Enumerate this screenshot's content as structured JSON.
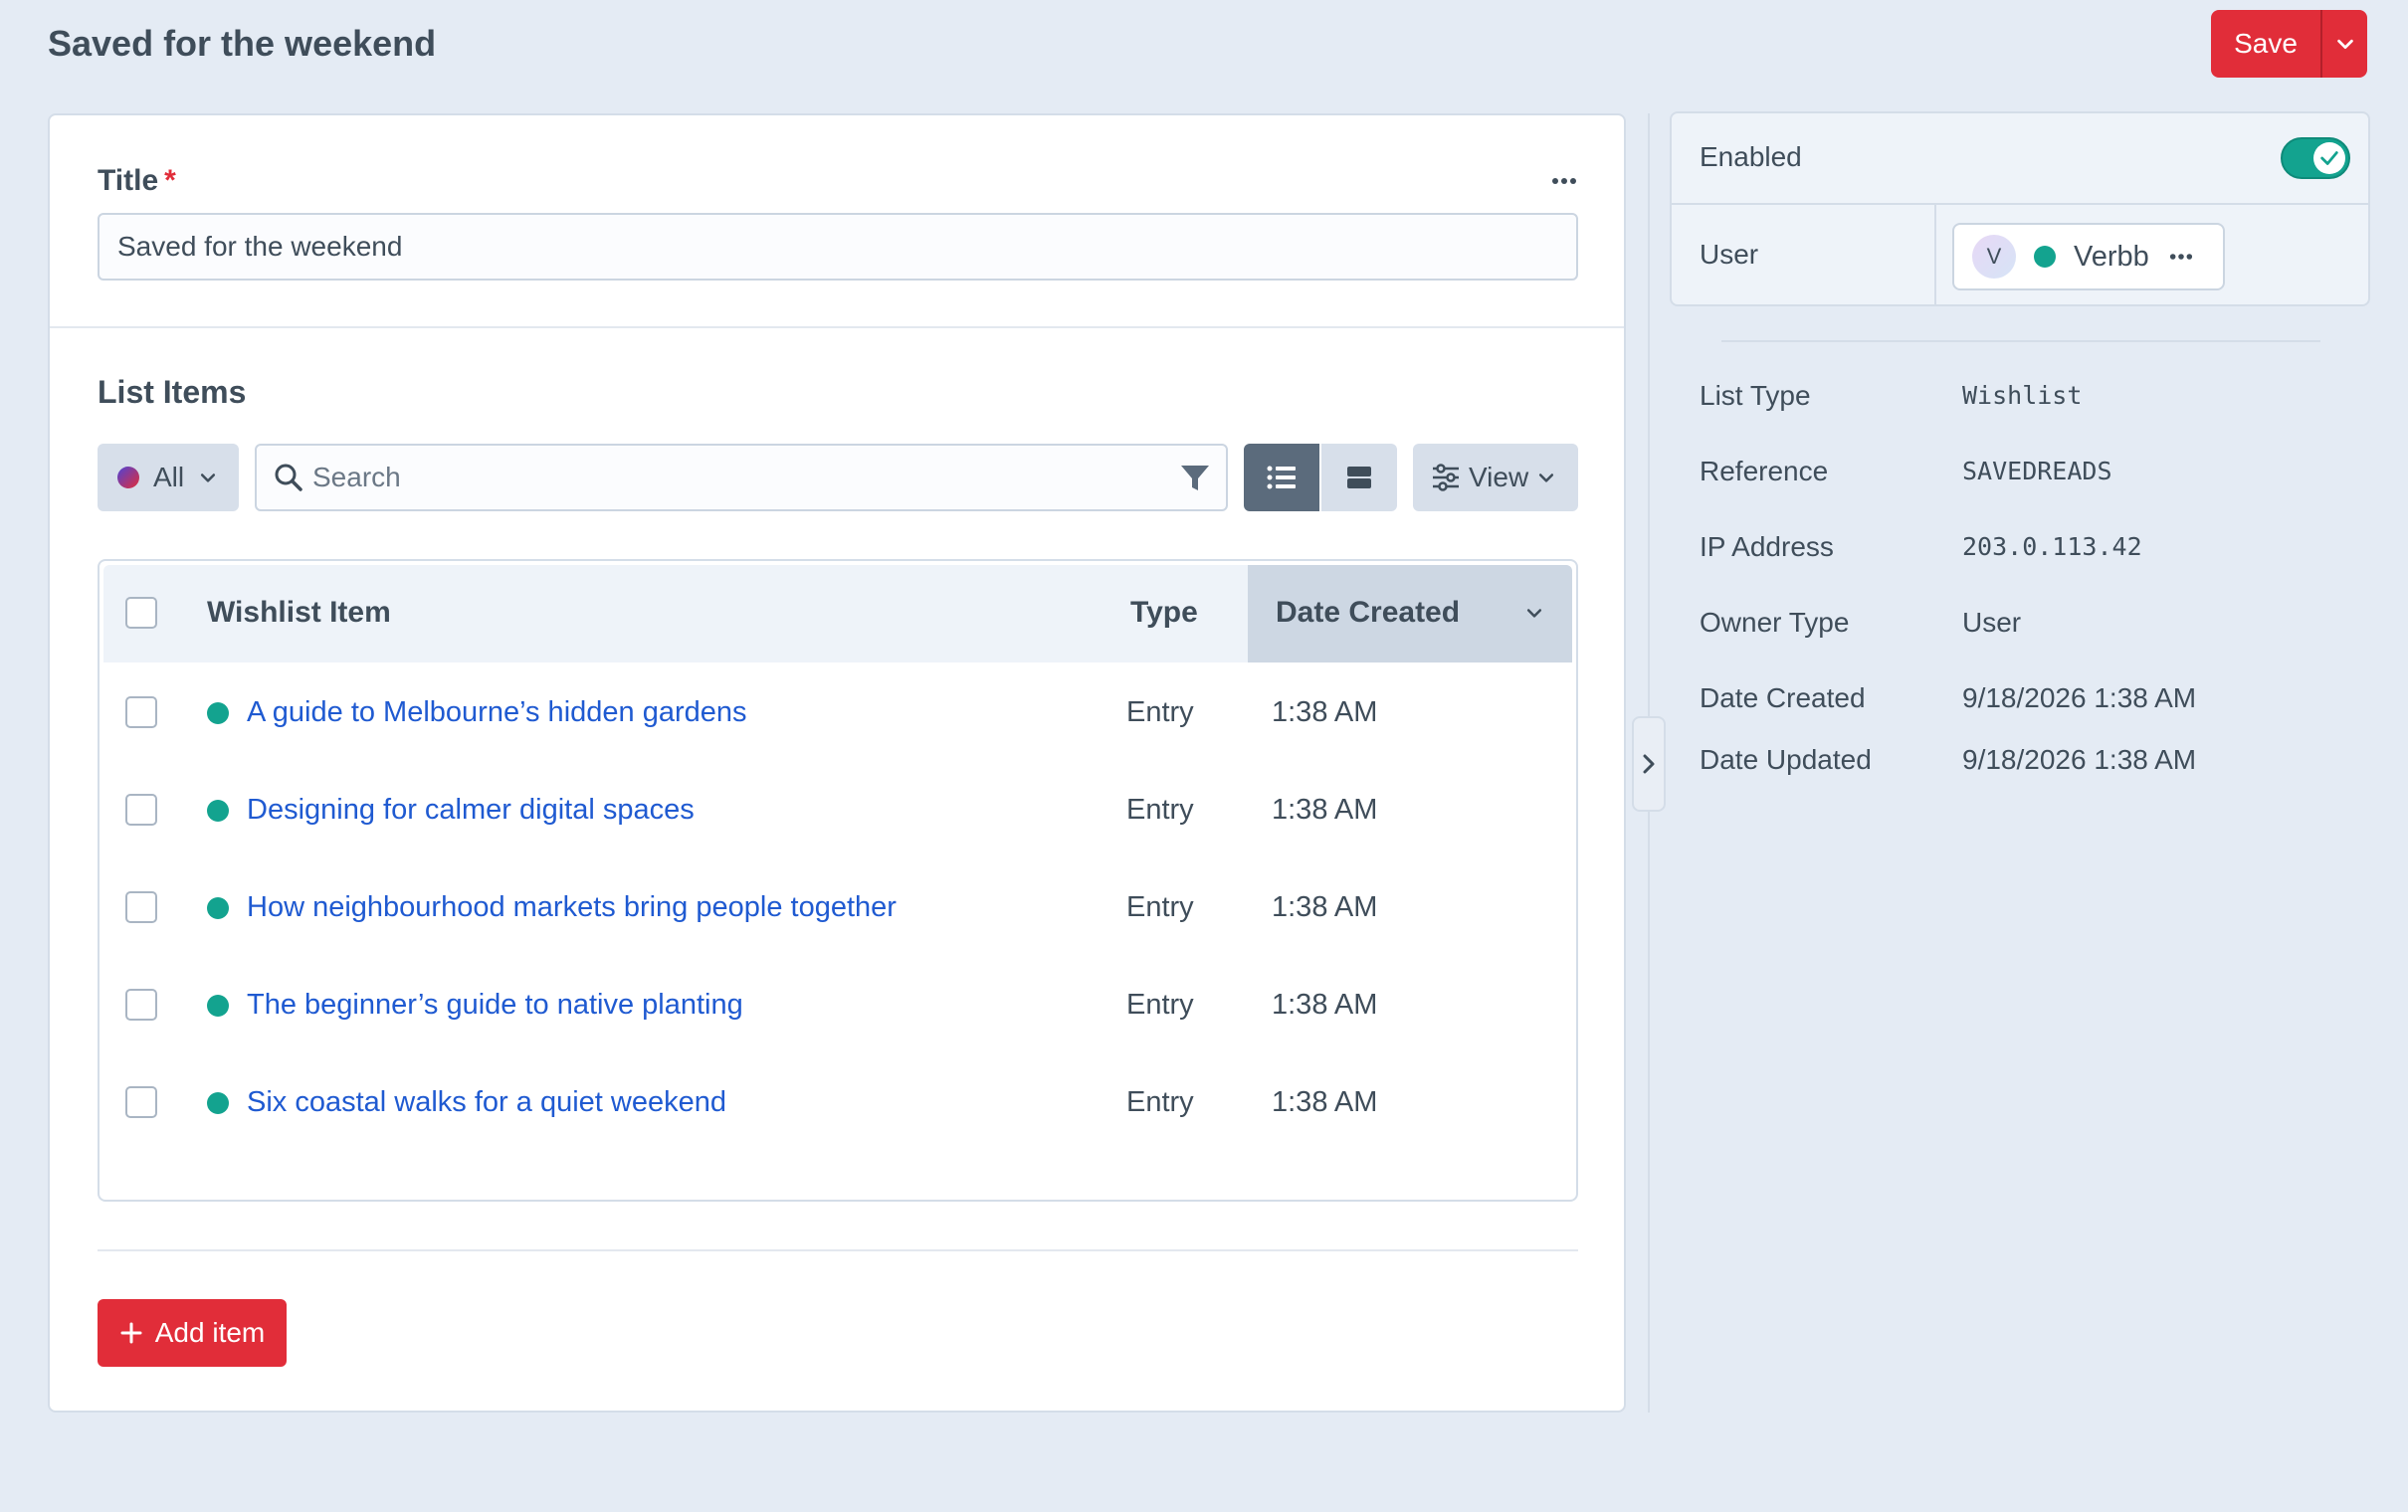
{
  "header": {
    "title": "Saved for the weekend",
    "save_label": "Save"
  },
  "fields": {
    "title_label": "Title",
    "required_mark": "*",
    "title_value": "Saved for the weekend"
  },
  "list_items": {
    "section_title": "List Items",
    "status_filter": "All",
    "search_placeholder": "Search",
    "view_label": "View",
    "columns": {
      "item": "Wishlist Item",
      "type": "Type",
      "date_created": "Date Created"
    },
    "rows": [
      {
        "title": "A guide to Melbourne’s hidden gardens",
        "type": "Entry",
        "date": "1:38 AM"
      },
      {
        "title": "Designing for calmer digital spaces",
        "type": "Entry",
        "date": "1:38 AM"
      },
      {
        "title": "How neighbourhood markets bring people together",
        "type": "Entry",
        "date": "1:38 AM"
      },
      {
        "title": "The beginner’s guide to native planting",
        "type": "Entry",
        "date": "1:38 AM"
      },
      {
        "title": "Six coastal walks for a quiet weekend",
        "type": "Entry",
        "date": "1:38 AM"
      }
    ],
    "add_label": "Add item"
  },
  "sidebar": {
    "enabled_label": "Enabled",
    "enabled": true,
    "user_label": "User",
    "user_initial": "V",
    "user_name": "Verbb",
    "info": [
      {
        "label": "List Type",
        "value": "Wishlist"
      },
      {
        "label": "Reference",
        "value": "SAVEDREADS"
      },
      {
        "label": "IP Address",
        "value": "203.0.113.42"
      },
      {
        "label": "Owner Type",
        "value": "User"
      },
      {
        "label": "Date Created",
        "value": "9/18/2026 1:38 AM"
      },
      {
        "label": "Date Updated",
        "value": "9/18/2026 1:38 AM"
      }
    ]
  },
  "colors": {
    "brand_red": "#e12d39",
    "status_green": "#13a38f",
    "link_blue": "#1f5ad1",
    "background": "#e4ebf4"
  },
  "icons": {
    "save_menu": "chevron-down-icon",
    "field_menu": "ellipsis-icon",
    "search": "search-icon",
    "filter": "filter-icon",
    "table_view": "list-icon",
    "card_view": "cards-icon",
    "view": "sliders-icon",
    "add": "plus-icon",
    "toggle": "check-icon",
    "collapse": "chevron-right-icon"
  }
}
